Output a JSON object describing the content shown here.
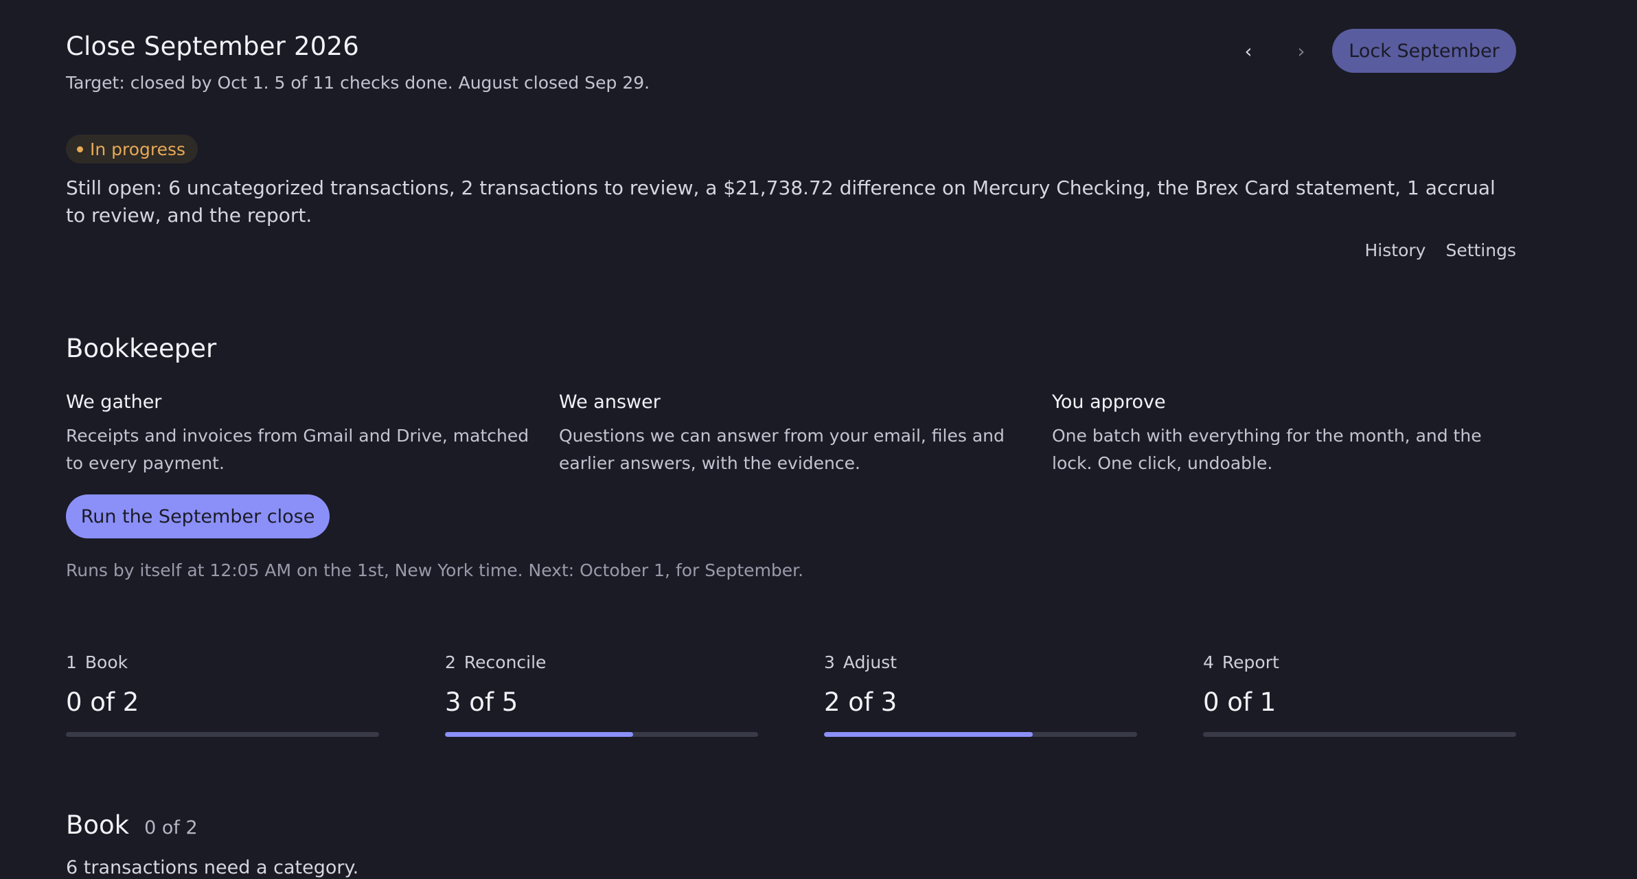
{
  "header": {
    "title": "Close September 2026",
    "subtitle": "Target: closed by Oct 1. 5 of 11 checks done. August closed Sep 29.",
    "prev_icon": "‹",
    "next_icon": "›",
    "lock_label": "Lock September"
  },
  "status": {
    "badge": "In progress",
    "badge_color": "#e7a957",
    "still_open": "Still open: 6 uncategorized transactions, 2 transactions to review, a $21,738.72 difference on Mercury Checking, the Brex Card statement, 1 accrual to review, and the report.",
    "history_label": "History",
    "settings_label": "Settings"
  },
  "bookkeeper": {
    "title": "Bookkeeper",
    "columns": [
      {
        "title": "We gather",
        "text": "Receipts and invoices from Gmail and Drive, matched to every payment."
      },
      {
        "title": "We answer",
        "text": "Questions we can answer from your email, files and earlier answers, with the evidence."
      },
      {
        "title": "You approve",
        "text": "One batch with everything for the month, and the lock. One click, undoable."
      }
    ],
    "run_label": "Run the September close",
    "runs_note": "Runs by itself at 12:05 AM on the 1st, New York time. Next: October 1, for September."
  },
  "steps": [
    {
      "num": "1",
      "name": "Book",
      "count": "0 of 2",
      "progress": 0
    },
    {
      "num": "2",
      "name": "Reconcile",
      "count": "3 of 5",
      "progress": 0.6
    },
    {
      "num": "3",
      "name": "Adjust",
      "count": "2 of 3",
      "progress": 0.6667
    },
    {
      "num": "4",
      "name": "Report",
      "count": "0 of 1",
      "progress": 0
    }
  ],
  "book_section": {
    "title": "Book",
    "count": "0 of 2",
    "note": "6 transactions need a category."
  },
  "colors": {
    "background": "#1b1b26",
    "accent": "#8b90f8",
    "lock_button": "#595c9f"
  }
}
